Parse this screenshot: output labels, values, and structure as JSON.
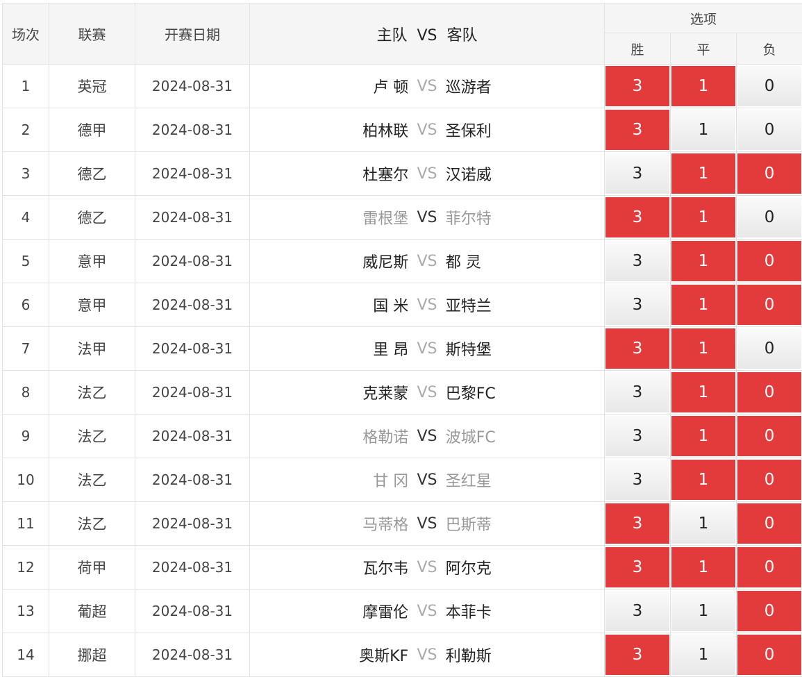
{
  "headers": {
    "idx": "场次",
    "league": "联赛",
    "date": "开赛日期",
    "match": "主队  VS  客队",
    "options": "选项",
    "win": "胜",
    "draw": "平",
    "lose": "负"
  },
  "vs_label": "VS",
  "rows": [
    {
      "idx": "1",
      "league": "英冠",
      "date": "2024-08-31",
      "home": "卢 顿",
      "away": "巡游者",
      "win": "3",
      "draw": "1",
      "lose": "0",
      "sel": [
        true,
        true,
        false
      ],
      "dim": false
    },
    {
      "idx": "2",
      "league": "德甲",
      "date": "2024-08-31",
      "home": "柏林联",
      "away": "圣保利",
      "win": "3",
      "draw": "1",
      "lose": "0",
      "sel": [
        true,
        false,
        false
      ],
      "dim": false
    },
    {
      "idx": "3",
      "league": "德乙",
      "date": "2024-08-31",
      "home": "杜塞尔",
      "away": "汉诺威",
      "win": "3",
      "draw": "1",
      "lose": "0",
      "sel": [
        false,
        true,
        true
      ],
      "dim": false
    },
    {
      "idx": "4",
      "league": "德乙",
      "date": "2024-08-31",
      "home": "雷根堡",
      "away": "菲尔特",
      "win": "3",
      "draw": "1",
      "lose": "0",
      "sel": [
        true,
        true,
        false
      ],
      "dim": true
    },
    {
      "idx": "5",
      "league": "意甲",
      "date": "2024-08-31",
      "home": "威尼斯",
      "away": "都 灵",
      "win": "3",
      "draw": "1",
      "lose": "0",
      "sel": [
        false,
        true,
        true
      ],
      "dim": false
    },
    {
      "idx": "6",
      "league": "意甲",
      "date": "2024-08-31",
      "home": "国 米",
      "away": "亚特兰",
      "win": "3",
      "draw": "1",
      "lose": "0",
      "sel": [
        false,
        true,
        true
      ],
      "dim": false
    },
    {
      "idx": "7",
      "league": "法甲",
      "date": "2024-08-31",
      "home": "里 昂",
      "away": "斯特堡",
      "win": "3",
      "draw": "1",
      "lose": "0",
      "sel": [
        true,
        true,
        false
      ],
      "dim": false
    },
    {
      "idx": "8",
      "league": "法乙",
      "date": "2024-08-31",
      "home": "克莱蒙",
      "away": "巴黎FC",
      "win": "3",
      "draw": "1",
      "lose": "0",
      "sel": [
        false,
        true,
        true
      ],
      "dim": false
    },
    {
      "idx": "9",
      "league": "法乙",
      "date": "2024-08-31",
      "home": "格勒诺",
      "away": "波城FC",
      "win": "3",
      "draw": "1",
      "lose": "0",
      "sel": [
        false,
        true,
        true
      ],
      "dim": true
    },
    {
      "idx": "10",
      "league": "法乙",
      "date": "2024-08-31",
      "home": "甘 冈",
      "away": "圣红星",
      "win": "3",
      "draw": "1",
      "lose": "0",
      "sel": [
        false,
        true,
        true
      ],
      "dim": true
    },
    {
      "idx": "11",
      "league": "法乙",
      "date": "2024-08-31",
      "home": "马蒂格",
      "away": "巴斯蒂",
      "win": "3",
      "draw": "1",
      "lose": "0",
      "sel": [
        true,
        false,
        true
      ],
      "dim": true
    },
    {
      "idx": "12",
      "league": "荷甲",
      "date": "2024-08-31",
      "home": "瓦尔韦",
      "away": "阿尔克",
      "win": "3",
      "draw": "1",
      "lose": "0",
      "sel": [
        true,
        true,
        true
      ],
      "dim": false
    },
    {
      "idx": "13",
      "league": "葡超",
      "date": "2024-08-31",
      "home": "摩雷伦",
      "away": "本菲卡",
      "win": "3",
      "draw": "1",
      "lose": "0",
      "sel": [
        false,
        false,
        true
      ],
      "dim": false
    },
    {
      "idx": "14",
      "league": "挪超",
      "date": "2024-08-31",
      "home": "奥斯KF",
      "away": "利勒斯",
      "win": "3",
      "draw": "1",
      "lose": "0",
      "sel": [
        true,
        false,
        true
      ],
      "dim": false
    }
  ],
  "colors": {
    "selected": "#e33b3b",
    "vs_dim": "#aaaaaa",
    "team_dim": "#999999"
  }
}
